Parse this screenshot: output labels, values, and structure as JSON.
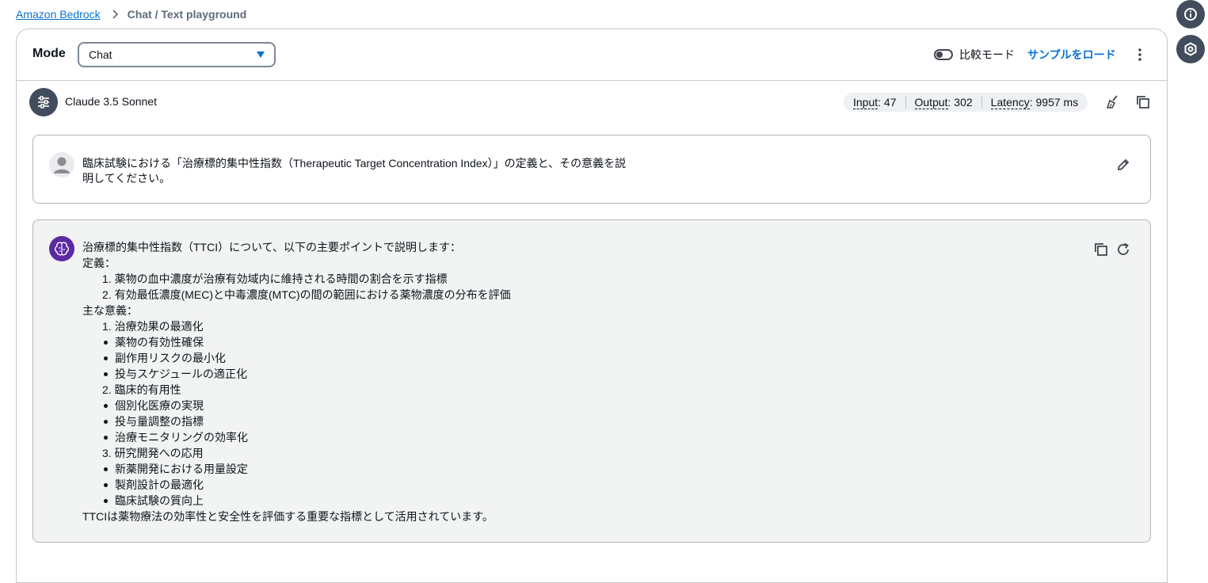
{
  "breadcrumb": {
    "root": "Amazon Bedrock",
    "current": "Chat / Text playground"
  },
  "mode": {
    "label": "Mode",
    "selected": "Chat",
    "compare_label": "比較モード",
    "compare_on": false,
    "load_sample": "サンプルをロード"
  },
  "model": {
    "name": "Claude 3.5 Sonnet",
    "metrics": {
      "input_key": "Input",
      "input_value": ": 47",
      "output_key": "Output",
      "output_value": ": 302",
      "latency_key": "Latency",
      "latency_value": ": 9957 ms"
    }
  },
  "user_message": {
    "line1": "臨床試験における「治療標的集中性指数（Therapeutic Target Concentration Index）」の定義と、その意義を説",
    "line2": "明してください。"
  },
  "assistant_message": {
    "lines": [
      {
        "type": "text",
        "text": "治療標的集中性指数（TTCI）について、以下の主要ポイントで説明します："
      },
      {
        "type": "text",
        "text": "定義："
      },
      {
        "type": "num",
        "text": "1. 薬物の血中濃度が治療有効域内に維持される時間の割合を示す指標"
      },
      {
        "type": "num",
        "text": "2. 有効最低濃度(MEC)と中毒濃度(MTC)の間の範囲における薬物濃度の分布を評価"
      },
      {
        "type": "text",
        "text": "主な意義："
      },
      {
        "type": "num",
        "text": "1. 治療効果の最適化"
      },
      {
        "type": "bullet",
        "text": "薬物の有効性確保"
      },
      {
        "type": "bullet",
        "text": "副作用リスクの最小化"
      },
      {
        "type": "bullet",
        "text": "投与スケジュールの適正化"
      },
      {
        "type": "num",
        "text": "2. 臨床的有用性"
      },
      {
        "type": "bullet",
        "text": "個別化医療の実現"
      },
      {
        "type": "bullet",
        "text": "投与量調整の指標"
      },
      {
        "type": "bullet",
        "text": "治療モニタリングの効率化"
      },
      {
        "type": "num",
        "text": "3. 研究開発への応用"
      },
      {
        "type": "bullet",
        "text": "新薬開発における用量設定"
      },
      {
        "type": "bullet",
        "text": "製剤設計の最適化"
      },
      {
        "type": "bullet",
        "text": "臨床試験の質向上"
      },
      {
        "type": "text",
        "text": "TTCIは薬物療法の効率性と安全性を評価する重要な指標として活用されています。"
      }
    ]
  },
  "icons": {
    "breadcrumb_separator": "chevron-right-icon",
    "info": "info-icon",
    "feedback": "feedback-icon",
    "mode_caret": "caret-down-icon",
    "more": "kebab-menu-icon",
    "model_settings": "settings-sliders-icon",
    "clear": "broom-icon",
    "copy": "copy-icon",
    "user": "user-profile-icon",
    "edit": "edit-pencil-icon",
    "assistant": "ai-brain-icon",
    "regenerate": "refresh-icon"
  },
  "colors": {
    "link": "#0972d3",
    "dark_button": "#414d5c",
    "assistant_avatar": "#5b2aa0",
    "assistant_bg": "#f2f3f3"
  }
}
